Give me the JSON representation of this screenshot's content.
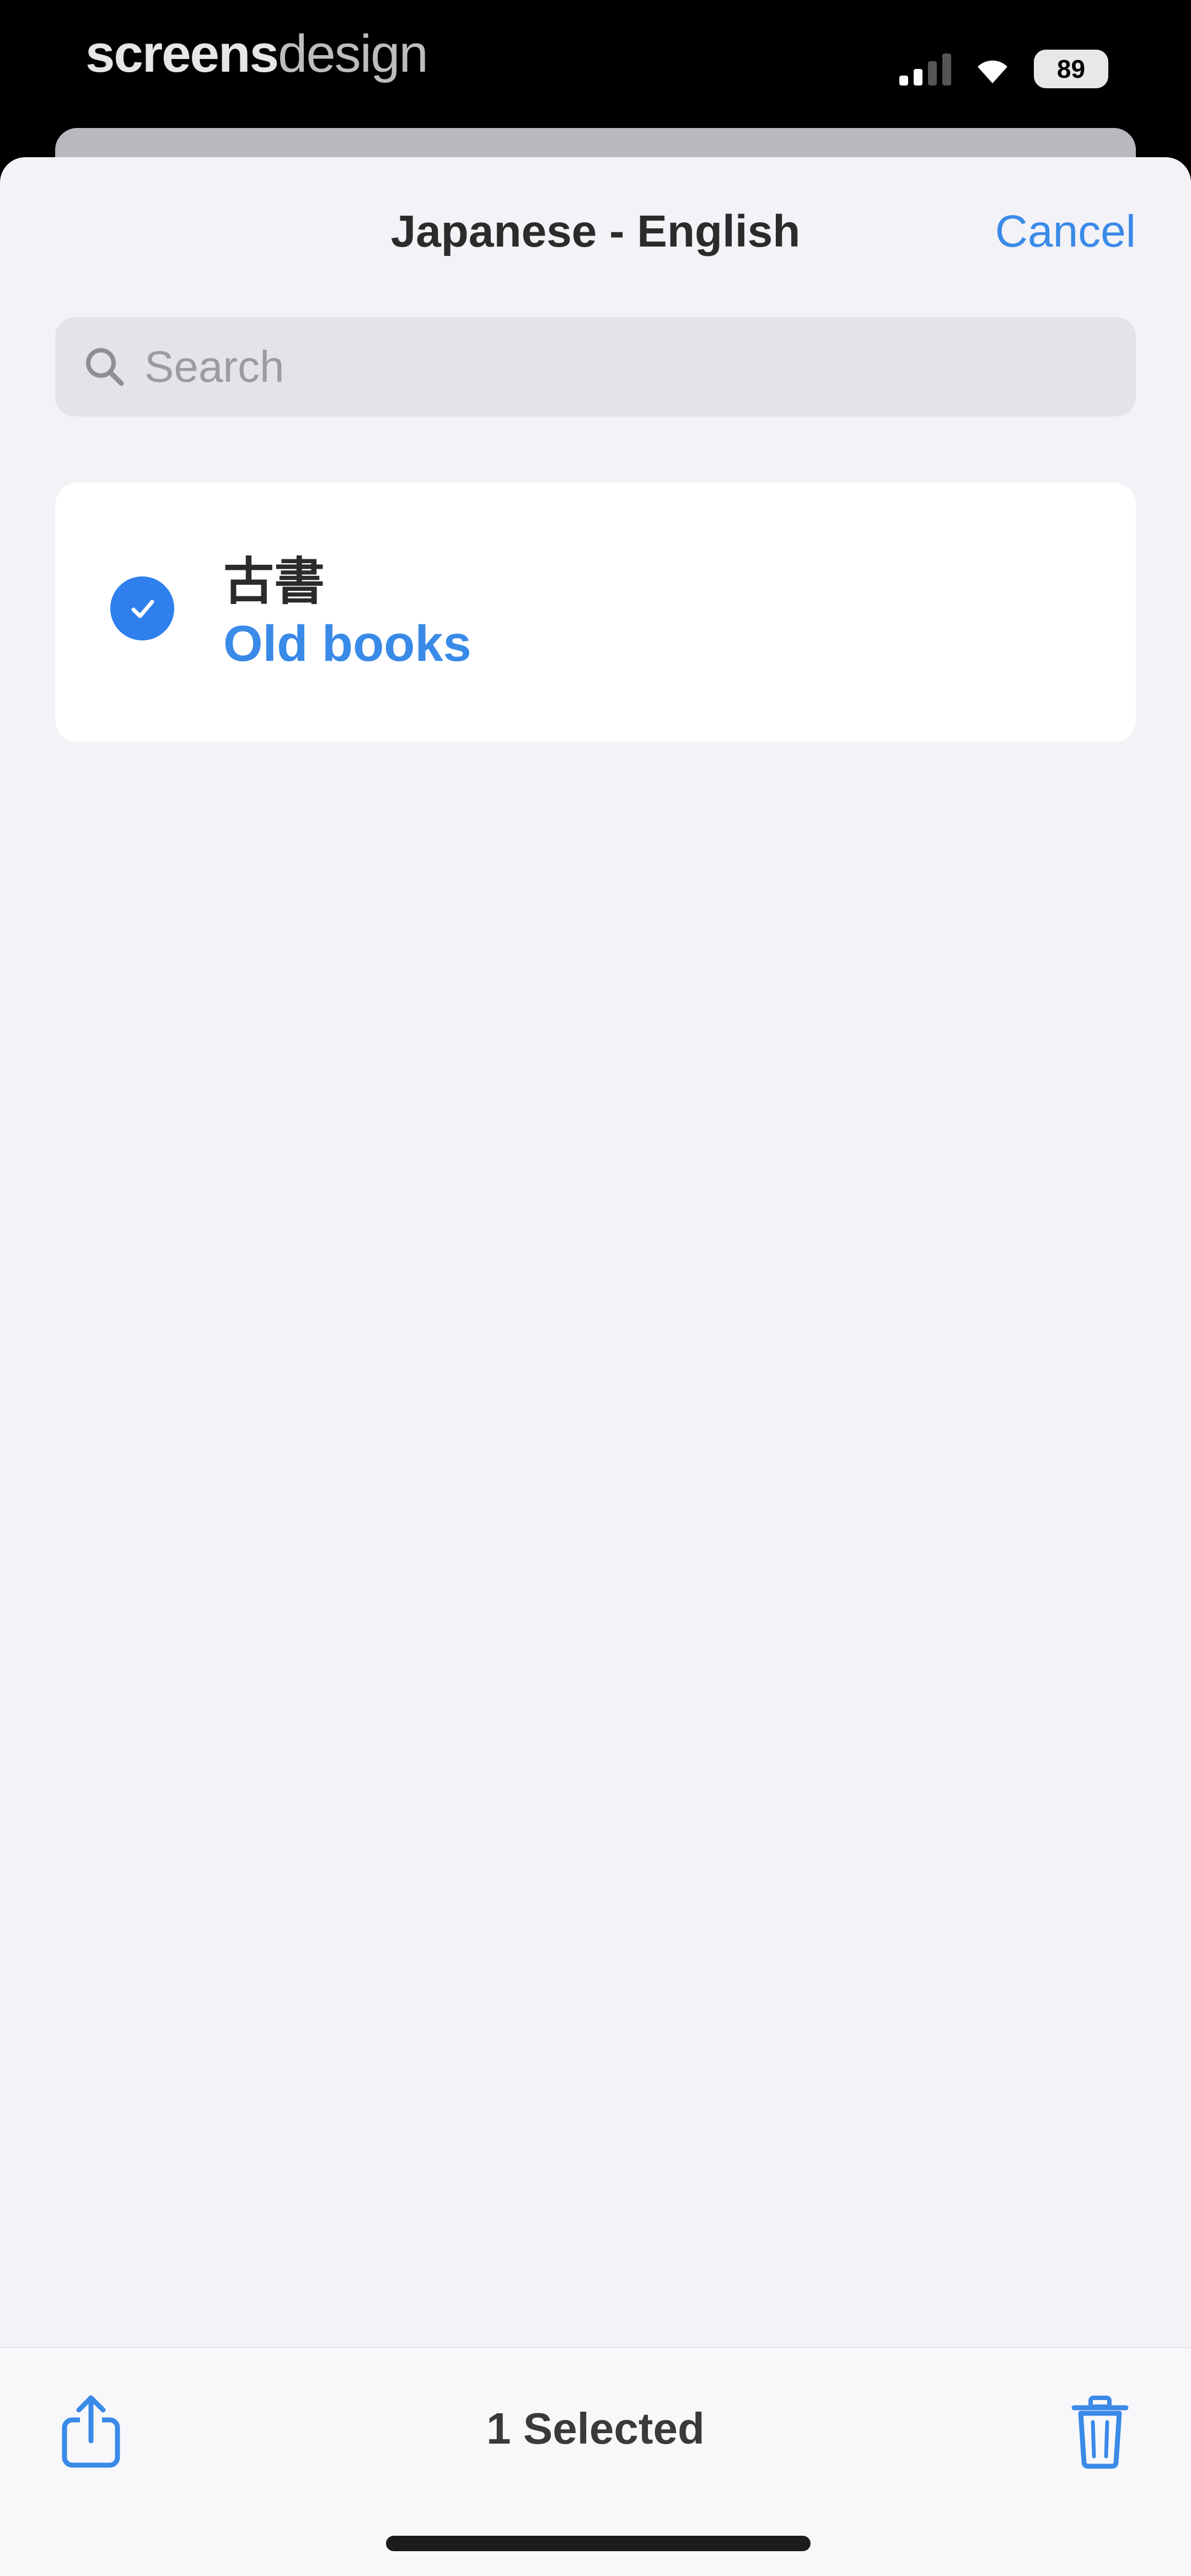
{
  "status_bar": {
    "brand_strong": "screens",
    "brand_light": "design",
    "battery": "89",
    "icons": [
      "signal-icon",
      "wifi-icon",
      "battery-icon"
    ]
  },
  "header": {
    "title": "Japanese - English",
    "cancel_label": "Cancel"
  },
  "search": {
    "placeholder": "Search",
    "value": ""
  },
  "entries": [
    {
      "term": "古書",
      "translation": "Old books",
      "selected": true
    }
  ],
  "toolbar": {
    "selected_label": "1 Selected",
    "icons": [
      "share-icon",
      "trash-icon"
    ]
  },
  "colors": {
    "accent": "#3a8ae8",
    "check": "#2f80ed",
    "sheet_background": "#f2f2f7"
  }
}
